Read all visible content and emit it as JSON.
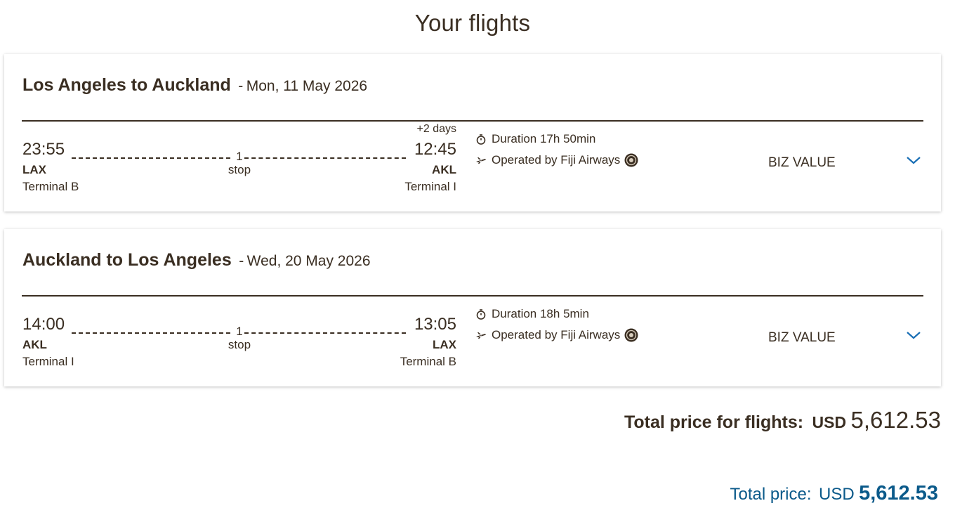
{
  "page_title": "Your flights",
  "flights": [
    {
      "route": "Los Angeles to Auckland",
      "separator": "-",
      "date": "Mon, 11 May 2026",
      "dep_time": "23:55",
      "arr_time": "12:45",
      "day_offset": "+2 days",
      "stops_count": "1",
      "stops_label": "stop",
      "dep_code": "LAX",
      "arr_code": "AKL",
      "dep_terminal": "Terminal B",
      "arr_terminal": "Terminal I",
      "duration": "Duration 17h 50min",
      "operated_by": "Operated by Fiji Airways",
      "cabin": "BIZ VALUE"
    },
    {
      "route": "Auckland to Los Angeles",
      "separator": "-",
      "date": "Wed, 20 May 2026",
      "dep_time": "14:00",
      "arr_time": "13:05",
      "day_offset": "",
      "stops_count": "1",
      "stops_label": "stop",
      "dep_code": "AKL",
      "arr_code": "LAX",
      "dep_terminal": "Terminal I",
      "arr_terminal": "Terminal B",
      "duration": "Duration 18h 5min",
      "operated_by": "Operated by Fiji Airways",
      "cabin": "BIZ VALUE"
    }
  ],
  "total_flights": {
    "label": "Total price for flights:",
    "currency": "USD",
    "amount": "5,612.53"
  },
  "total_price": {
    "label": "Total price:",
    "currency": "USD",
    "amount": "5,612.53"
  },
  "colors": {
    "text": "#3a2e22",
    "accent": "#0b5a8a",
    "chevron": "#1a6fb5"
  },
  "icons": {
    "duration": "stopwatch-icon",
    "operated_by": "plane-icon",
    "airline_logo": "fiji-airways-logo",
    "expand": "chevron-down-icon"
  }
}
